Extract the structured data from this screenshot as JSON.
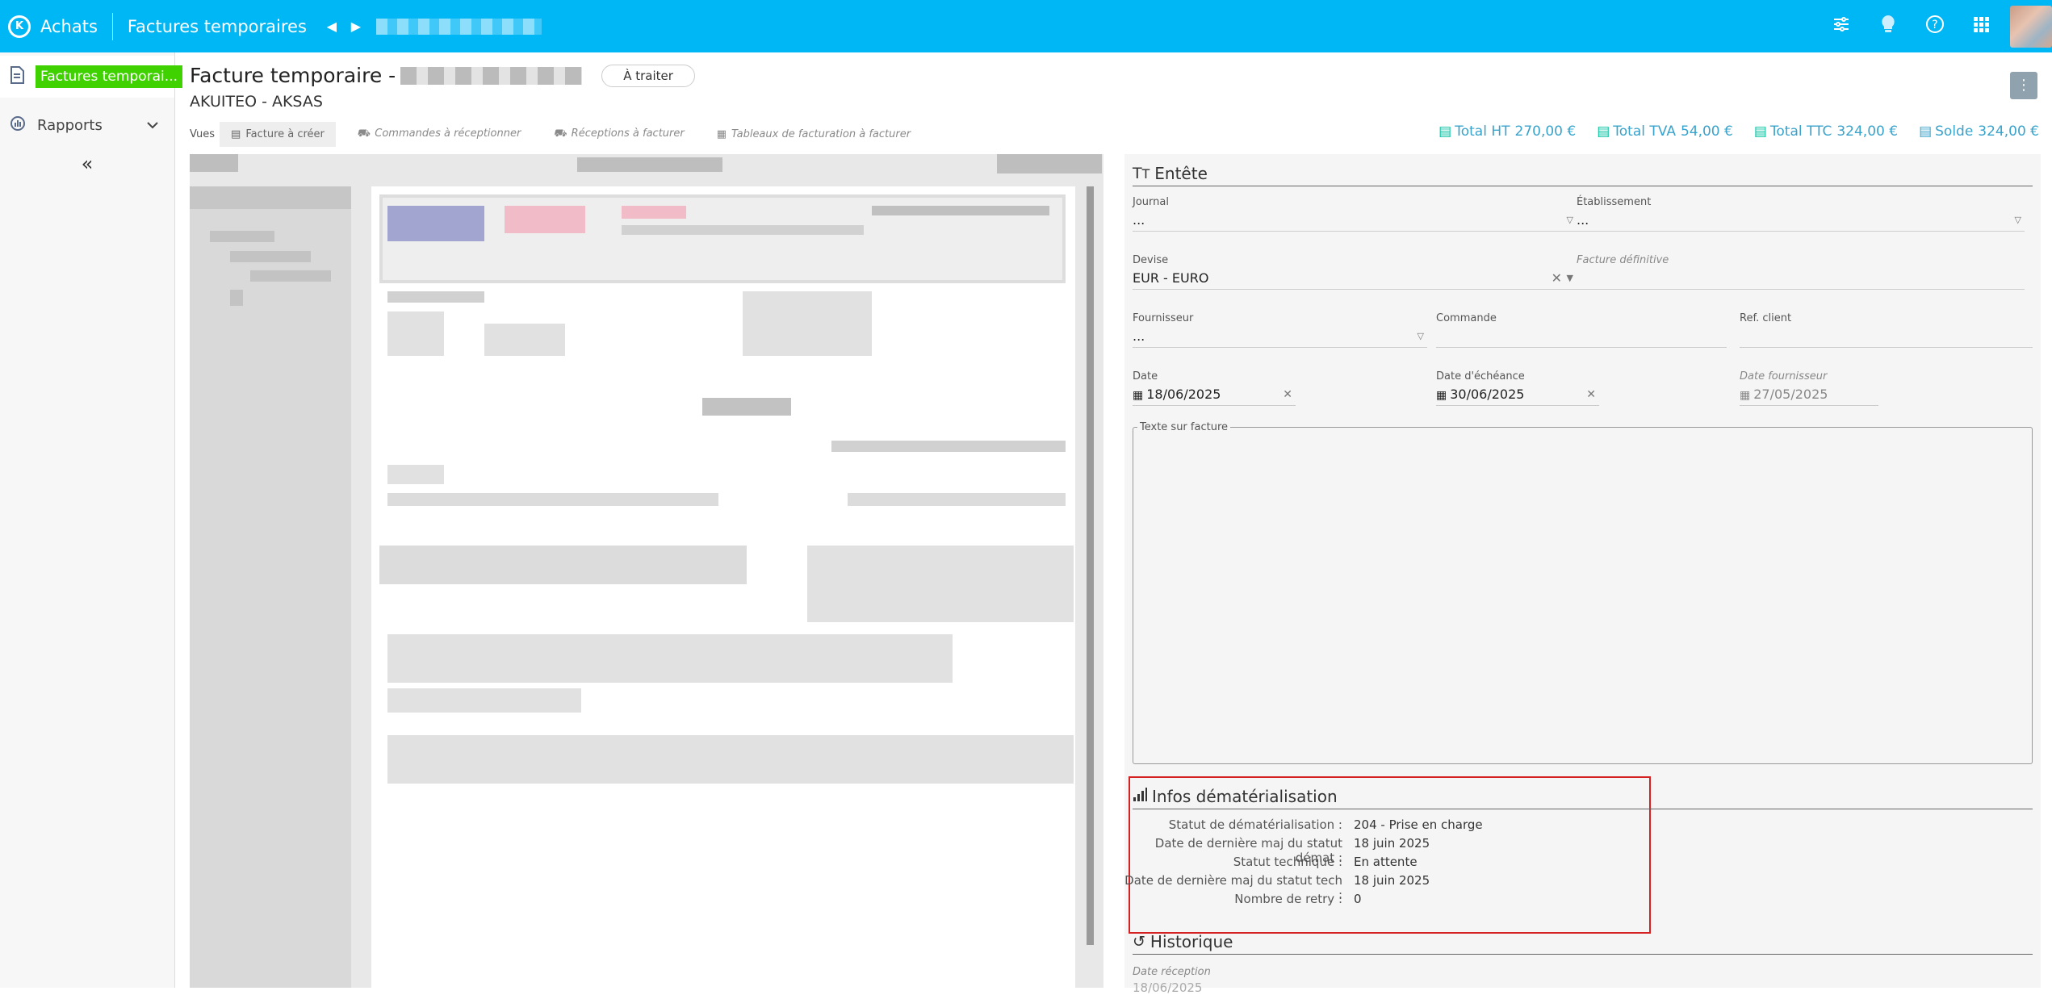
{
  "topbar": {
    "logo": "K",
    "app": "Achats",
    "crumb": "Factures temporaires",
    "prev_icon": "◀",
    "next_icon": "▶",
    "icons": [
      "settings-sliders-icon",
      "lightbulb-icon",
      "help-icon",
      "apps-grid-icon"
    ]
  },
  "sidebar": {
    "items": [
      {
        "label": "Factures temporai...",
        "icon": "invoice-icon",
        "active": true
      },
      {
        "label": "Rapports",
        "icon": "reports-icon",
        "active": false
      }
    ],
    "collapse": "«"
  },
  "header": {
    "title": "Facture temporaire -",
    "status_badge": "À traiter",
    "subtitle": "AKUITEO - AKSAS",
    "menu_icon": "⋮"
  },
  "views": {
    "label": "Vues",
    "tabs": [
      {
        "label": "Facture à créer",
        "selected": true
      },
      {
        "label": "Commandes à réceptionner",
        "selected": false
      },
      {
        "label": "Réceptions à facturer",
        "selected": false
      },
      {
        "label": "Tableaux de facturation à facturer",
        "selected": false
      }
    ]
  },
  "totals": [
    {
      "label": "Total HT",
      "value": "270,00 €"
    },
    {
      "label": "Total TVA",
      "value": "54,00 €"
    },
    {
      "label": "Total TTC",
      "value": "324,00 €"
    },
    {
      "label": "Solde",
      "value": "324,00 €"
    }
  ],
  "form": {
    "entete_title": "Entête",
    "journal": {
      "label": "Journal",
      "value": "..."
    },
    "etablissement": {
      "label": "Établissement",
      "value": "..."
    },
    "devise": {
      "label": "Devise",
      "value": "EUR - EURO"
    },
    "facture_definitive": {
      "label": "Facture définitive",
      "value": ""
    },
    "fournisseur": {
      "label": "Fournisseur",
      "value": "..."
    },
    "commande": {
      "label": "Commande",
      "value": ""
    },
    "ref_client": {
      "label": "Ref. client",
      "value": ""
    },
    "date": {
      "label": "Date",
      "value": "18/06/2025"
    },
    "date_echeance": {
      "label": "Date d'échéance",
      "value": "30/06/2025"
    },
    "date_fournisseur": {
      "label": "Date fournisseur",
      "value": "27/05/2025"
    },
    "texte_facture": {
      "label": "Texte sur facture",
      "value": ""
    }
  },
  "demat": {
    "title": "Infos dématérialisation",
    "rows": [
      {
        "key": "Statut de dématérialisation :",
        "value": "204 - Prise en charge"
      },
      {
        "key": "Date de dernière maj du statut démat :",
        "value": "18 juin 2025"
      },
      {
        "key": "Statut technique :",
        "value": "En attente"
      },
      {
        "key": "Date de dernière maj du statut tech :",
        "value": "18 juin 2025"
      },
      {
        "key": "Nombre de retry :",
        "value": "0"
      }
    ]
  },
  "historique": {
    "title": "Historique",
    "date_reception_label": "Date réception",
    "date_reception_value": "18/06/2025"
  }
}
